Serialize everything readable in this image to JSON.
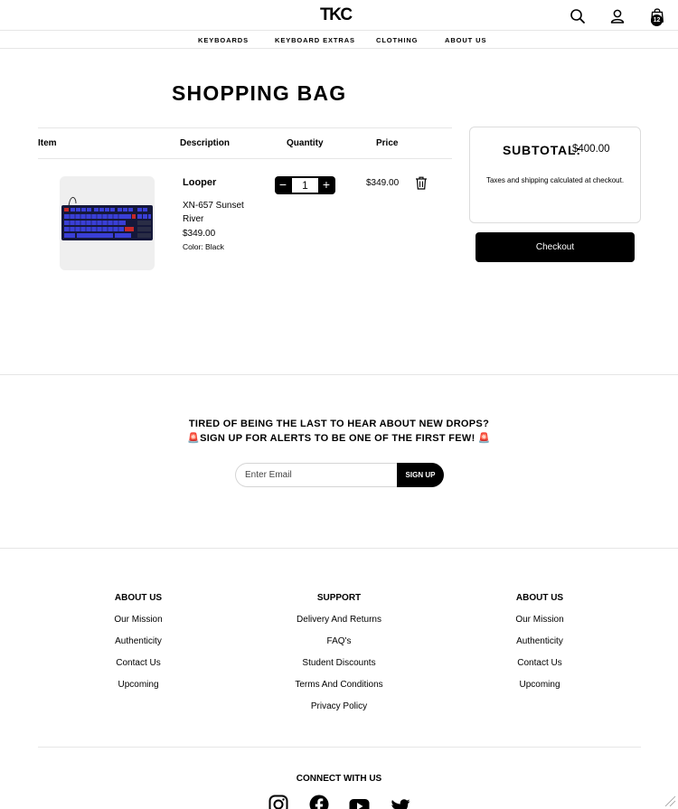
{
  "header": {
    "logo": "TKC",
    "cart_count": "12",
    "nav": [
      "KEYBOARDS",
      "KEYBOARD EXTRAS",
      "CLOTHING",
      "ABOUT US"
    ],
    "icons": [
      "search-icon",
      "user-icon",
      "shopping-bag-icon"
    ]
  },
  "page_title": "SHOPPING BAG",
  "cart": {
    "columns": [
      "Item",
      "Description",
      "Quantity",
      "Price"
    ],
    "item": {
      "name": "Looper",
      "variant": "XN-657 Sunset River",
      "unit_price": "$349.00",
      "color": "Color: Black",
      "quantity": "1",
      "line_price": "$349.00",
      "minus": "−",
      "plus": "+"
    }
  },
  "summary": {
    "subtotal_label": "SUBTOTAL:",
    "subtotal_value": "$400.00",
    "tax_note": "Taxes and shipping calculated at checkout.",
    "checkout_label": "Checkout"
  },
  "signup": {
    "line1": "TIRED OF BEING THE LAST TO HEAR ABOUT NEW DROPS?",
    "line2": "SIGN UP FOR ALERTS TO BE ONE OF THE FIRST FEW!",
    "siren": "🚨",
    "email_placeholder": "Enter Email",
    "button": "SIGN UP"
  },
  "footer": {
    "columns": [
      {
        "heading": "ABOUT US",
        "links": [
          "Our Mission",
          "Authenticity",
          "Contact Us",
          "Upcoming"
        ]
      },
      {
        "heading": "SUPPORT",
        "links": [
          "Delivery And Returns",
          "FAQ's",
          "Student Discounts",
          "Terms And Conditions",
          "Privacy Policy"
        ]
      },
      {
        "heading": "ABOUT US",
        "links": [
          "Our Mission",
          "Authenticity",
          "Contact Us",
          "Upcoming"
        ]
      }
    ],
    "connect": "CONNECT WITH US",
    "social": [
      "instagram-icon",
      "facebook-icon",
      "youtube-icon",
      "twitter-icon"
    ]
  }
}
